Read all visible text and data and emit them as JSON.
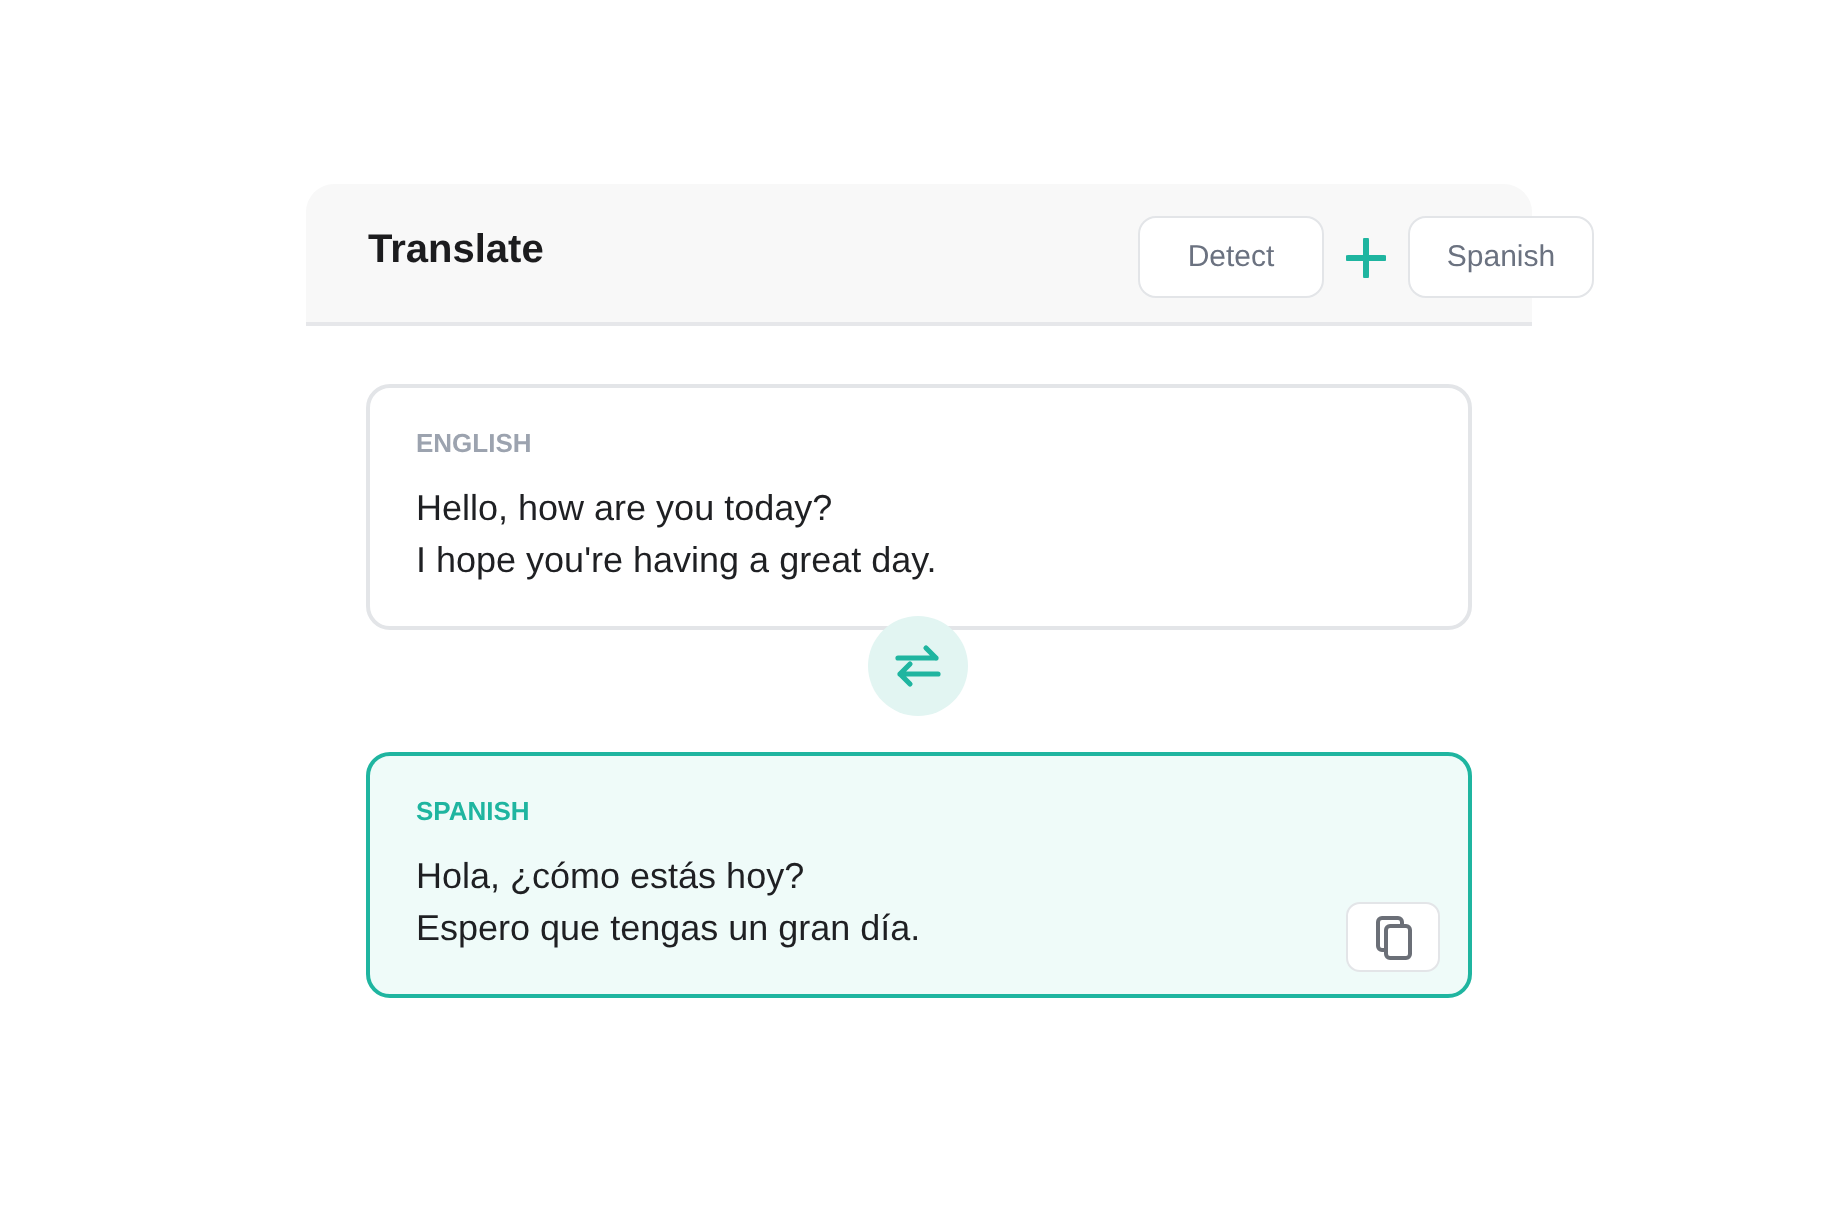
{
  "header": {
    "title": "Translate",
    "source_button": "Detect",
    "target_button": "Spanish"
  },
  "panels": [
    {
      "kind": "source",
      "language": "ENGLISH",
      "text": "Hello, how are you today?\nI hope you're having a great day."
    },
    {
      "kind": "target",
      "language": "SPANISH",
      "text": "Hola, ¿cómo estás hoy?\nEspero que tengas un gran día."
    }
  ]
}
